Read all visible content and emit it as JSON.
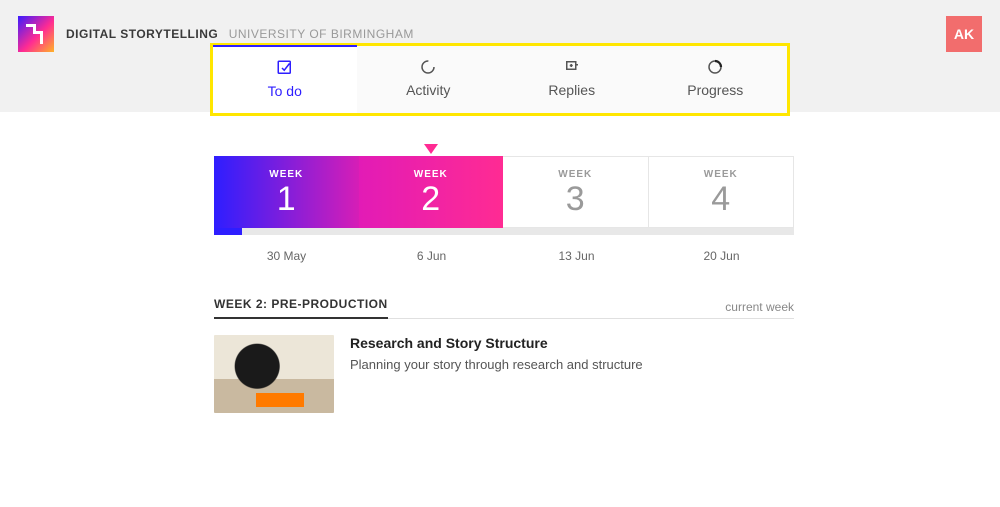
{
  "header": {
    "course_title": "Digital Storytelling",
    "institution": "University of Birmingham",
    "avatar_initials": "AK"
  },
  "tabs": [
    {
      "label": "To do",
      "active": true,
      "icon": "checkbox-icon"
    },
    {
      "label": "Activity",
      "active": false,
      "icon": "spinner-icon"
    },
    {
      "label": "Replies",
      "active": false,
      "icon": "reply-plus-icon"
    },
    {
      "label": "Progress",
      "active": false,
      "icon": "progress-ring-icon"
    }
  ],
  "weeks": [
    {
      "label": "WEEK",
      "number": "1",
      "date": "30 May",
      "style": "grad1",
      "progress": 0.19
    },
    {
      "label": "WEEK",
      "number": "2",
      "date": "6 Jun",
      "style": "grad2",
      "current": true
    },
    {
      "label": "WEEK",
      "number": "3",
      "date": "13 Jun",
      "style": "plain"
    },
    {
      "label": "WEEK",
      "number": "4",
      "date": "20 Jun",
      "style": "plain"
    }
  ],
  "section": {
    "title": "WEEK 2: PRE-PRODUCTION",
    "meta": "current week"
  },
  "activities": [
    {
      "title": "Research and Story Structure",
      "description": "Planning your story through research and structure"
    }
  ],
  "colors": {
    "accent_blue": "#2e1eff",
    "accent_pink": "#ff2b93",
    "highlight_yellow": "#ffe600"
  }
}
